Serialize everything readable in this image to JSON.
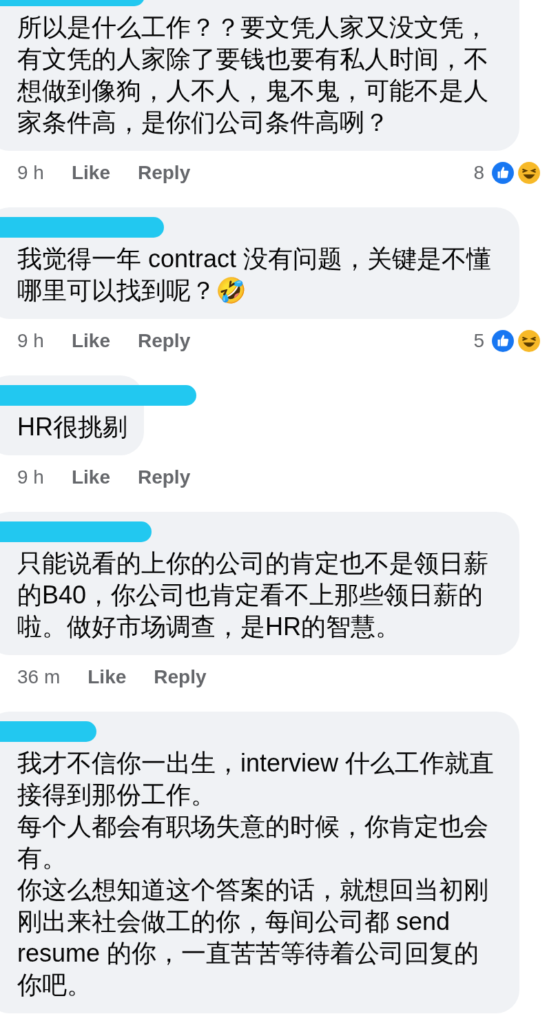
{
  "comments": [
    {
      "redacted": true,
      "text": "所以是什么工作？？要文凭人家又没文凭，有文凭的人家除了要钱也要有私人时间，不想做到像狗，人不人，鬼不鬼，可能不是人家条件高，是你们公司条件高咧？",
      "time": "9 h",
      "like": "Like",
      "reply": "Reply",
      "reaction_count": "8"
    },
    {
      "redacted": true,
      "text": "我觉得一年 contract 没有问题，关键是不懂哪里可以找到呢？🤣",
      "time": "9 h",
      "like": "Like",
      "reply": "Reply",
      "reaction_count": "5"
    },
    {
      "redacted": true,
      "text": "HR很挑剔",
      "time": "9 h",
      "like": "Like",
      "reply": "Reply"
    },
    {
      "redacted": true,
      "text": "只能说看的上你的公司的肯定也不是领日薪的B40，你公司也肯定看不上那些领日薪的啦。做好市场调查，是HR的智慧。",
      "time": "36 m",
      "like": "Like",
      "reply": "Reply"
    },
    {
      "redacted": true,
      "paragraphs": [
        "我才不信你一出生，interview 什么工作就直接得到那份工作。",
        "每个人都会有职场失意的时候，你肯定也会有。",
        "你这么想知道这个答案的话，就想回当初刚刚出来社会做工的你，每间公司都 send resume 的你，一直苦苦等待着公司回复的你吧。"
      ]
    }
  ]
}
